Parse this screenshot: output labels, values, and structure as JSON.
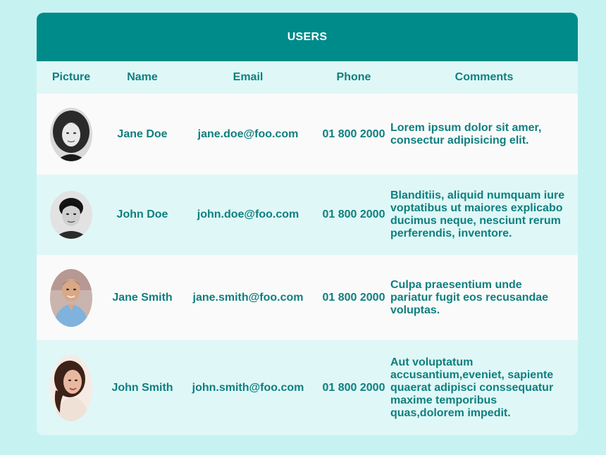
{
  "header": {
    "title": "USERS"
  },
  "columns": {
    "picture": "Picture",
    "name": "Name",
    "email": "Email",
    "phone": "Phone",
    "comments": "Comments"
  },
  "users": [
    {
      "avatar": "portrait-woman-curly-hair-bw",
      "name": "Jane Doe",
      "email": "jane.doe@foo.com",
      "phone": "01 800 2000",
      "comment": "Lorem ipsum dolor sit amer, consectur adipisicing elit."
    },
    {
      "avatar": "portrait-man-dark-hair-bw",
      "name": "John Doe",
      "email": "john.doe@foo.com",
      "phone": "01 800 2000",
      "comment": "Blanditiis, aliquid numquam iure voptatibus ut maiores explicabo ducimus neque, nesciunt rerum perferendis, inventore."
    },
    {
      "avatar": "portrait-man-blue-shirt",
      "name": "Jane Smith",
      "email": "jane.smith@foo.com",
      "phone": "01 800 2000",
      "comment": "Culpa praesentium unde pariatur fugit eos recusandae voluptas."
    },
    {
      "avatar": "portrait-woman-dark-hair",
      "name": "John Smith",
      "email": "john.smith@foo.com",
      "phone": "01 800 2000",
      "comment": "Aut voluptatum accusantium,eveniet, sapiente quaerat adipisci conssequatur maxime temporibus quas,dolorem impedit."
    }
  ],
  "colors": {
    "page_background": "#c7f2f2",
    "header_background": "#008b8b",
    "header_text": "#ffffff",
    "cell_text": "#0f7f7f",
    "row_light": "#fafafa",
    "row_tinted": "#dff7f7"
  }
}
